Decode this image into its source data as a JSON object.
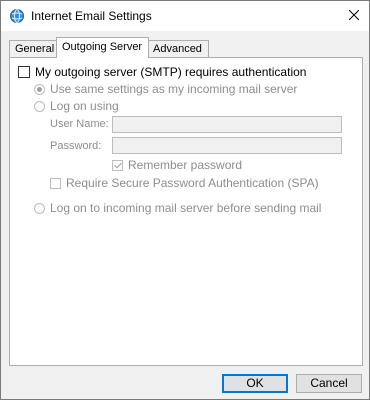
{
  "window": {
    "title": "Internet Email Settings"
  },
  "tabs": [
    {
      "label": "General"
    },
    {
      "label": "Outgoing Server"
    },
    {
      "label": "Advanced"
    }
  ],
  "smtp": {
    "requires_auth_label": "My outgoing server (SMTP) requires authentication",
    "requires_auth_checked": false,
    "use_same_label": "Use same settings as my incoming mail server",
    "logon_using_label": "Log on using",
    "username_label": "User Name:",
    "username_value": "",
    "password_label": "Password:",
    "password_value": "",
    "remember_password_label": "Remember password",
    "spa_label": "Require Secure Password Authentication (SPA)",
    "logon_incoming_label": "Log on to incoming mail server before sending mail"
  },
  "buttons": {
    "ok": "OK",
    "cancel": "Cancel"
  },
  "icons": {
    "app": "globe-envelope-icon",
    "close": "close-icon"
  },
  "colors": {
    "accent": "#0078d7"
  }
}
